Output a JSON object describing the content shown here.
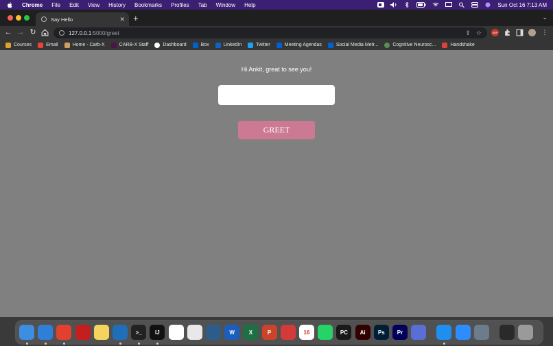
{
  "menubar": {
    "app_name": "Chrome",
    "items": [
      "File",
      "Edit",
      "View",
      "History",
      "Bookmarks",
      "Profiles",
      "Tab",
      "Window",
      "Help"
    ],
    "clock": "Sun Oct 16  7:13 AM"
  },
  "tab": {
    "title": "Say Hello"
  },
  "omnibox": {
    "host": "127.0.0.1",
    "path": ":5000/greet"
  },
  "bookmarks": [
    {
      "label": "Courses",
      "color": "#e0a030"
    },
    {
      "label": "Email",
      "color": "#ea4335"
    },
    {
      "label": "Home - Carb-X",
      "color": "#d0a060"
    },
    {
      "label": "CARB-X Staff",
      "color": "#4a154b"
    },
    {
      "label": "Dashboard",
      "color": "#ffffff"
    },
    {
      "label": "Box",
      "color": "#0061d5"
    },
    {
      "label": "LinkedIn",
      "color": "#0a66c2"
    },
    {
      "label": "Twitter",
      "color": "#1da1f2"
    },
    {
      "label": "Meeting Agendas",
      "color": "#0061d5"
    },
    {
      "label": "Social Media Metr...",
      "color": "#0061d5"
    },
    {
      "label": "Cognitive Neurosc...",
      "color": "#5b8c5a"
    },
    {
      "label": "Handshake",
      "color": "#e0403a"
    }
  ],
  "page": {
    "greeting": "Hi Ankit, great to see you!",
    "input_value": "",
    "button_label": "GREET",
    "button_color": "#cc7a93",
    "background": "#808080"
  },
  "dock": [
    {
      "name": "finder-icon",
      "color": "#3d8de0",
      "text": ""
    },
    {
      "name": "safari-icon",
      "color": "#2f7fd8",
      "text": ""
    },
    {
      "name": "chrome-icon",
      "color": "#e2412f",
      "text": ""
    },
    {
      "name": "acrobat-icon",
      "color": "#c41e1e",
      "text": ""
    },
    {
      "name": "notes-icon",
      "color": "#f4d35e",
      "text": ""
    },
    {
      "name": "vscode-icon",
      "color": "#1e6fb8",
      "text": ""
    },
    {
      "name": "terminal-icon",
      "color": "#222222",
      "text": ">_"
    },
    {
      "name": "intellij-icon",
      "color": "#111111",
      "text": "IJ"
    },
    {
      "name": "word-app-icon",
      "color": "#ffffff",
      "text": ""
    },
    {
      "name": "tableau-icon",
      "color": "#e8e8e8",
      "text": ""
    },
    {
      "name": "mysql-workbench-icon",
      "color": "#2c5d8a",
      "text": ""
    },
    {
      "name": "word-icon",
      "color": "#1b5ebe",
      "text": "W"
    },
    {
      "name": "excel-icon",
      "color": "#1d7044",
      "text": "X"
    },
    {
      "name": "powerpoint-icon",
      "color": "#c9442a",
      "text": "P"
    },
    {
      "name": "pdf-expert-icon",
      "color": "#d33b3b",
      "text": ""
    },
    {
      "name": "calendar-icon",
      "color": "#ffffff",
      "text": "16"
    },
    {
      "name": "whatsapp-icon",
      "color": "#25d366",
      "text": ""
    },
    {
      "name": "pycharm-icon",
      "color": "#1a1a1a",
      "text": "PC"
    },
    {
      "name": "illustrator-icon",
      "color": "#330000",
      "text": "Ai"
    },
    {
      "name": "photoshop-icon",
      "color": "#001e36",
      "text": "Ps"
    },
    {
      "name": "premiere-icon",
      "color": "#00005b",
      "text": "Pr"
    },
    {
      "name": "navigator-icon",
      "color": "#5a6fd6",
      "text": ""
    },
    {
      "name": "app-store-icon",
      "color": "#1f8ef1",
      "text": ""
    },
    {
      "name": "zoom-icon",
      "color": "#2d8cff",
      "text": ""
    },
    {
      "name": "quicktime-icon",
      "color": "#6b7c8c",
      "text": ""
    },
    {
      "name": "activity-monitor-icon",
      "color": "#2a2a2a",
      "text": ""
    },
    {
      "name": "trash-icon",
      "color": "#9a9a9a",
      "text": ""
    }
  ]
}
